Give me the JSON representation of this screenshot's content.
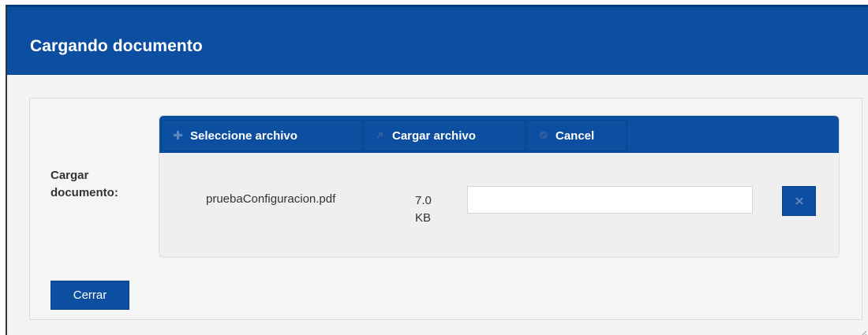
{
  "dialog": {
    "title": "Cargando documento"
  },
  "form": {
    "label_line1": "Cargar",
    "label_line2": "documento:"
  },
  "toolbar": {
    "select_label": "Seleccione archivo",
    "select_icon": "plus-icon",
    "upload_label": "Cargar archivo",
    "upload_icon": "upload-arrow-icon",
    "cancel_label": "Cancel",
    "cancel_icon": "cancel-circle-icon"
  },
  "file": {
    "name": "pruebaConfiguracion.pdf",
    "size_value": "7.0",
    "size_unit": "KB",
    "progress": 0,
    "remove_icon": "close-icon"
  },
  "footer": {
    "close_label": "Cerrar"
  },
  "colors": {
    "brand_blue": "#0c4fa0",
    "background": "#f4f4f4",
    "muted_icon": "#5f86bf"
  }
}
